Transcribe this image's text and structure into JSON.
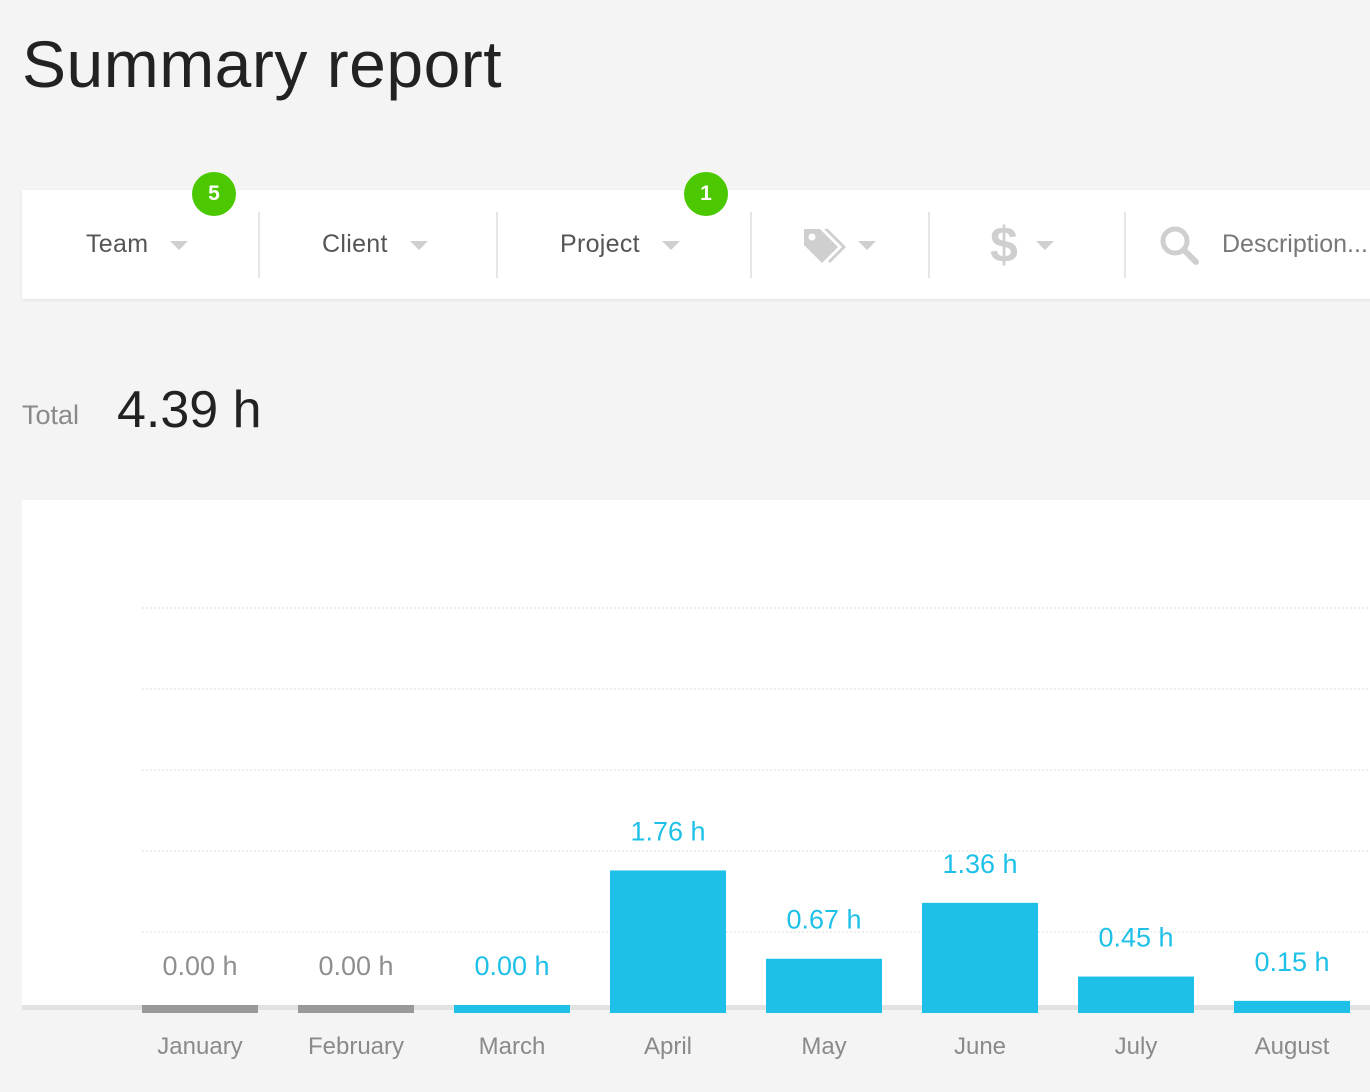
{
  "page": {
    "title": "Summary report"
  },
  "filters": {
    "team": {
      "label": "Team",
      "badge": "5"
    },
    "client": {
      "label": "Client"
    },
    "project": {
      "label": "Project",
      "badge": "1"
    },
    "tags": {
      "icon": "tag-icon"
    },
    "billable": {
      "icon": "dollar-icon"
    },
    "description": {
      "icon": "search-icon",
      "placeholder": "Description..."
    }
  },
  "total": {
    "label": "Total",
    "value": "4.39 h"
  },
  "colors": {
    "bar_active": "#1ec0e8",
    "bar_empty": "#999999",
    "badge": "#4bc800"
  },
  "chart_data": {
    "type": "bar",
    "categories": [
      "January",
      "February",
      "March",
      "April",
      "May",
      "June",
      "July",
      "August"
    ],
    "values": [
      0.0,
      0.0,
      0.0,
      1.76,
      0.67,
      1.36,
      0.45,
      0.15
    ],
    "value_labels": [
      "0.00 h",
      "0.00 h",
      "0.00 h",
      "1.76 h",
      "0.67 h",
      "1.36 h",
      "0.45 h",
      "0.15 h"
    ],
    "label_colors": [
      "#8f8f8f",
      "#8f8f8f",
      "#1ec0e8",
      "#1ec0e8",
      "#1ec0e8",
      "#1ec0e8",
      "#1ec0e8",
      "#1ec0e8"
    ],
    "ylim": [
      0,
      5
    ],
    "grid": true
  }
}
